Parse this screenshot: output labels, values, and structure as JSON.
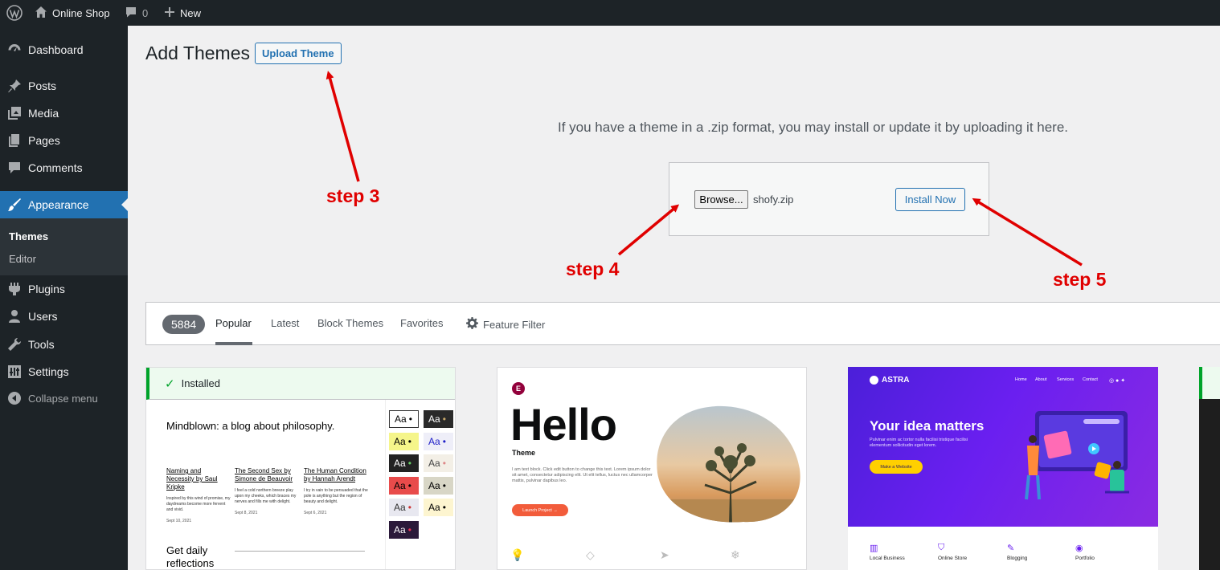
{
  "admin_bar": {
    "site_name": "Online Shop",
    "comments_count": "0",
    "new_label": "New"
  },
  "sidebar": {
    "items": [
      {
        "label": "Dashboard",
        "icon": "dashboard-icon"
      },
      {
        "label": "Posts",
        "icon": "pin-icon"
      },
      {
        "label": "Media",
        "icon": "media-icon"
      },
      {
        "label": "Pages",
        "icon": "pages-icon"
      },
      {
        "label": "Comments",
        "icon": "comments-icon"
      },
      {
        "label": "Appearance",
        "icon": "paintbrush-icon"
      },
      {
        "label": "Plugins",
        "icon": "plugin-icon"
      },
      {
        "label": "Users",
        "icon": "users-icon"
      },
      {
        "label": "Tools",
        "icon": "wrench-icon"
      },
      {
        "label": "Settings",
        "icon": "settings-icon"
      }
    ],
    "submenu": [
      "Themes",
      "Editor"
    ],
    "collapse_label": "Collapse menu"
  },
  "page": {
    "title": "Add Themes",
    "upload_button": "Upload Theme",
    "upload_help": "If you have a theme in a .zip format, you may install or update it by uploading it here.",
    "browse_button": "Browse...",
    "file_name": "shofy.zip",
    "install_button": "Install Now"
  },
  "annotations": [
    "step 3",
    "step 4",
    "step 5"
  ],
  "filter_bar": {
    "count": "5884",
    "tabs": [
      "Popular",
      "Latest",
      "Block Themes",
      "Favorites"
    ],
    "feature_filter": "Feature Filter"
  },
  "theme_cards": {
    "card1": {
      "installed_label": "Installed",
      "headline": "Mindblown: a blog about philosophy.",
      "posts": [
        {
          "title": "Naming and Necessity by Saul Kripke",
          "body": "Inspired by this wind of promise, my daydreams become more fervent and vivid.",
          "date": "Sept 10, 2021"
        },
        {
          "title": "The Second Sex by Simone de Beauvoir",
          "body": "I feel a cold northern breeze play upon my cheeks, which braces my nerves and fills me with delight.",
          "date": "Sept 8, 2021"
        },
        {
          "title": "The Human Condition by Hannah Arendt",
          "body": "I try in vain to be persuaded that the pole is anything but the region of beauty and delight.",
          "date": "Sept 6, 2021"
        }
      ],
      "daily": "Get daily reflections",
      "swatch_label": "Aa"
    },
    "card2": {
      "logo": "E",
      "headline": "Hello",
      "subtitle": "Theme",
      "description": "I am text block. Click edit button to change this text. Lorem ipsum dolor sit amet, consectetur adipiscing elit. Ut elit tellus, luctus nec ullamcorper mattis, pulvinar dapibus leo.",
      "cta": "Launch Project →"
    },
    "card3": {
      "brand": "ASTRA",
      "nav": [
        "Home",
        "About",
        "Services",
        "Contact"
      ],
      "title": "Your idea matters",
      "description": "Pulvinar enim ac tortor nulla facilisi tristique facilisi elementum sollicitudin eget lorem.",
      "button": "Make a Website",
      "features": [
        "Local Business",
        "Online Store",
        "Blogging",
        "Portfolio"
      ]
    }
  },
  "colors": {
    "admin_dark": "#1d2327",
    "accent_blue": "#2271b1",
    "annotation_red": "#e00000",
    "installed_green": "#00a32a",
    "astra_purple": "#6a1ff0"
  }
}
